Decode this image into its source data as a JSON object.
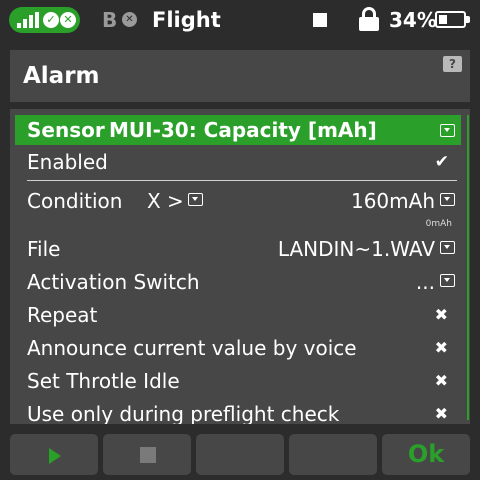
{
  "status": {
    "receiver_b_label": "B",
    "title": "Flight",
    "battery_pct": "34%",
    "battery_level": 0.34,
    "accent": "#2aa02a"
  },
  "header": {
    "title": "Alarm",
    "help_label": "?"
  },
  "sensor": {
    "label": "Sensor",
    "value": "MUI-30: Capacity [mAh]"
  },
  "rows": {
    "enabled": {
      "label": "Enabled",
      "icon": "checkmark-icon"
    },
    "condition": {
      "label": "Condition",
      "operator": "X >",
      "value": "160mAh",
      "current": "0mAh"
    },
    "file": {
      "label": "File",
      "value": "LANDIN~1.WAV"
    },
    "activation": {
      "label": "Activation Switch",
      "value": "..."
    },
    "repeat": {
      "label": "Repeat",
      "icon": "x-icon"
    },
    "announce": {
      "label": "Announce current value by voice",
      "icon": "x-icon"
    },
    "throttle": {
      "label": "Set Throtle Idle",
      "icon": "x-icon"
    },
    "preflight": {
      "label": "Use only during preflight check",
      "icon": "x-icon"
    }
  },
  "buttons": {
    "ok_label": "Ok"
  }
}
